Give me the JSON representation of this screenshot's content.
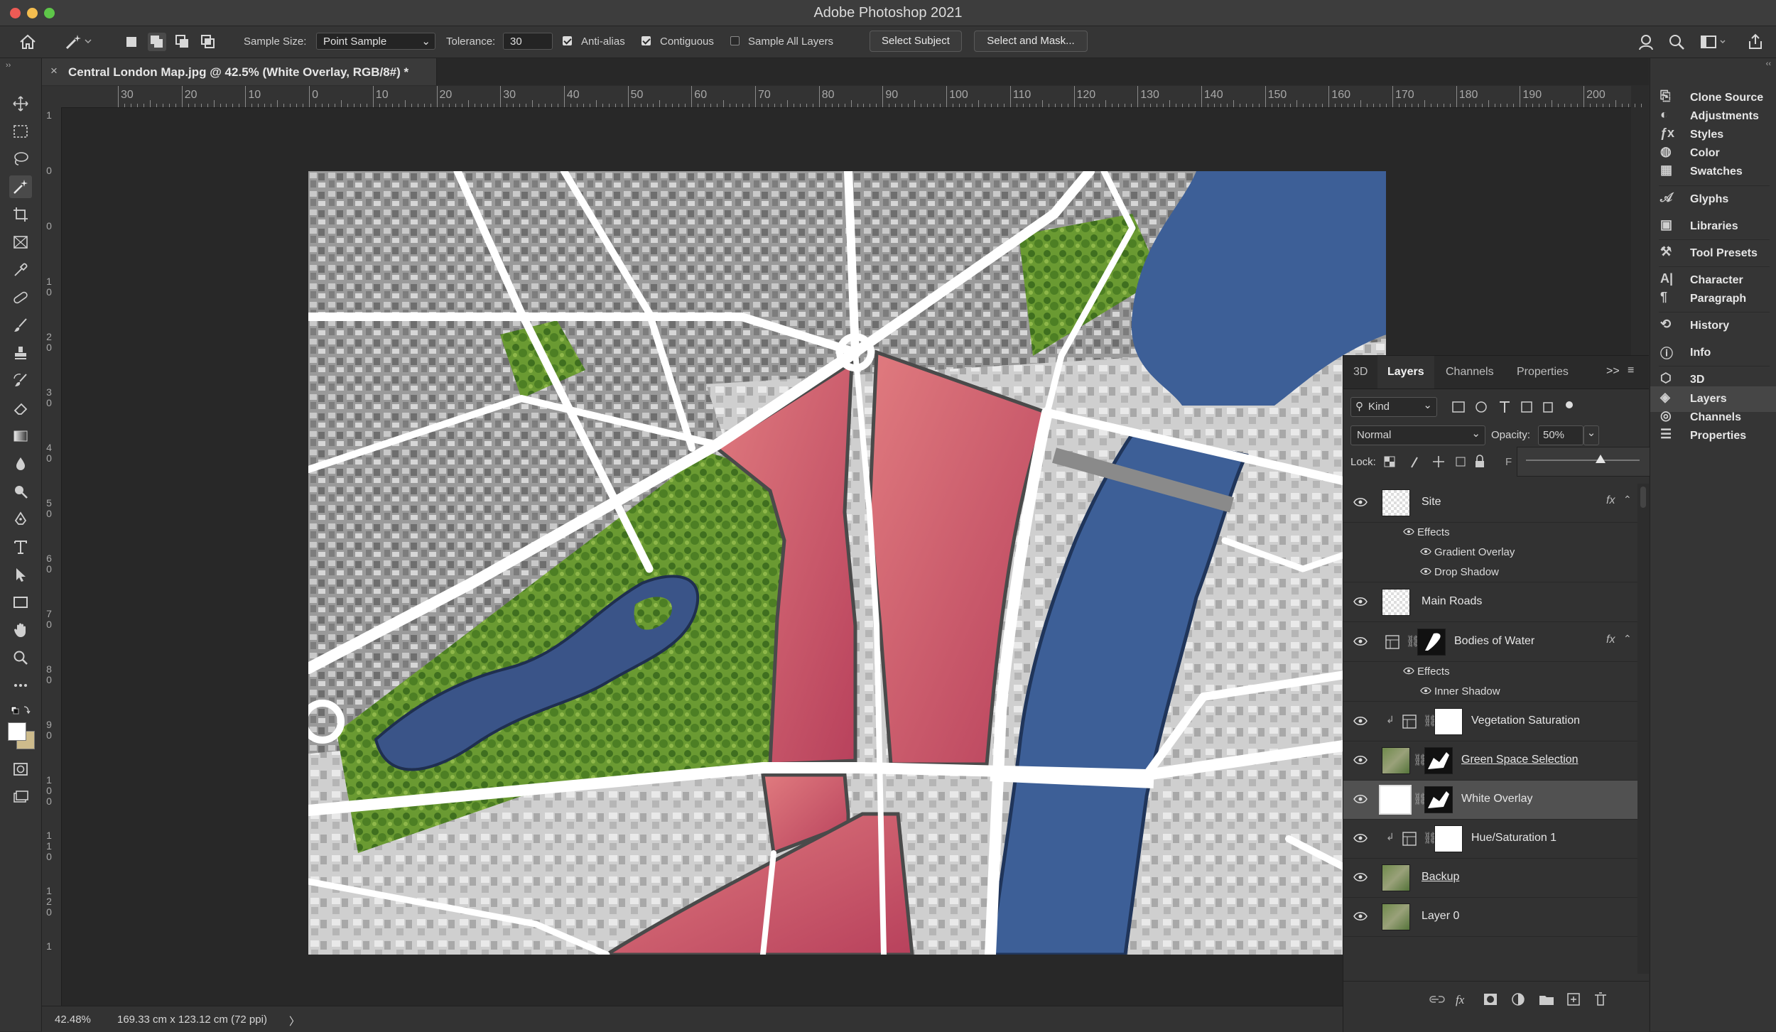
{
  "app": {
    "title": "Adobe Photoshop 2021"
  },
  "window_controls": {
    "close_color": "#ee5b55",
    "minimize_color": "#f4bd4f",
    "zoom_color": "#5ec649"
  },
  "options_bar": {
    "sample_size_label": "Sample Size:",
    "sample_size_value": "Point Sample",
    "tolerance_label": "Tolerance:",
    "tolerance_value": "30",
    "anti_alias_label": "Anti-alias",
    "anti_alias_checked": true,
    "contiguous_label": "Contiguous",
    "contiguous_checked": true,
    "sample_all_layers_label": "Sample All Layers",
    "sample_all_layers_checked": false,
    "select_subject_label": "Select Subject",
    "select_and_mask_label": "Select and Mask..."
  },
  "document": {
    "tab_title": "Central London Map.jpg @ 42.5% (White Overlay, RGB/8#) *",
    "close_glyph": "×"
  },
  "rulers": {
    "horizontal": [
      "30",
      "20",
      "10",
      "0",
      "10",
      "20",
      "30",
      "40",
      "50",
      "60",
      "70",
      "80",
      "90",
      "100",
      "110",
      "120",
      "130",
      "140",
      "150",
      "160",
      "170",
      "180",
      "190",
      "200"
    ],
    "vertical": [
      "1",
      "0",
      "0",
      "1 0",
      "2 0",
      "3 0",
      "4 0",
      "5 0",
      "6 0",
      "7 0",
      "8 0",
      "9 0",
      "1 0 0",
      "1 1 0",
      "1 2 0",
      "1"
    ]
  },
  "status_bar": {
    "zoom": "42.48%",
    "doc_info": "169.33 cm x 123.12 cm (72 ppi)",
    "arrow": "〉"
  },
  "dock": {
    "items": [
      {
        "label": "Clone Source",
        "icon": "clone-source-icon"
      },
      {
        "label": "Adjustments",
        "icon": "adjustments-icon"
      },
      {
        "label": "Styles",
        "icon": "styles-icon"
      },
      {
        "label": "Color",
        "icon": "color-icon"
      },
      {
        "label": "Swatches",
        "icon": "swatches-icon"
      },
      {
        "label": "Glyphs",
        "icon": "glyphs-icon"
      },
      {
        "label": "Libraries",
        "icon": "libraries-icon"
      },
      {
        "label": "Tool Presets",
        "icon": "tool-presets-icon"
      },
      {
        "label": "Character",
        "icon": "character-icon"
      },
      {
        "label": "Paragraph",
        "icon": "paragraph-icon"
      },
      {
        "label": "History",
        "icon": "history-icon"
      },
      {
        "label": "Info",
        "icon": "info-icon"
      },
      {
        "label": "3D",
        "icon": "3d-icon"
      },
      {
        "label": "Layers",
        "icon": "layers-icon"
      },
      {
        "label": "Channels",
        "icon": "channels-icon"
      },
      {
        "label": "Properties",
        "icon": "properties-icon"
      }
    ]
  },
  "layers_panel": {
    "tabs": [
      "3D",
      "Layers",
      "Channels",
      "Properties"
    ],
    "active_tab": "Layers",
    "more_glyph": ">>",
    "filter_kind": "Kind",
    "blend_mode": "Normal",
    "opacity_label": "Opacity:",
    "opacity_value": "50%",
    "opacity_slider_fraction": 0.5,
    "lock_label": "Lock:",
    "fill_letter": "F",
    "layers": [
      {
        "name": "Site",
        "fx": "fx",
        "effects_label": "Effects",
        "effects": [
          "Gradient Overlay",
          "Drop Shadow"
        ]
      },
      {
        "name": "Main Roads"
      },
      {
        "name": "Bodies of Water",
        "fx": "fx",
        "effects_label": "Effects",
        "effects": [
          "Inner Shadow"
        ]
      },
      {
        "name": "Vegetation Saturation"
      },
      {
        "name": "Green Space Selection"
      },
      {
        "name": "White Overlay",
        "selected": true
      },
      {
        "name": "Hue/Saturation 1"
      },
      {
        "name": "Backup"
      },
      {
        "name": "Layer 0"
      }
    ]
  },
  "colors": {
    "site_red": "#c9566a",
    "water_blue": "#3d5f97",
    "road_white": "#ffffff",
    "vegetation": "#5a8a2c",
    "selected_layer": "#515151"
  }
}
